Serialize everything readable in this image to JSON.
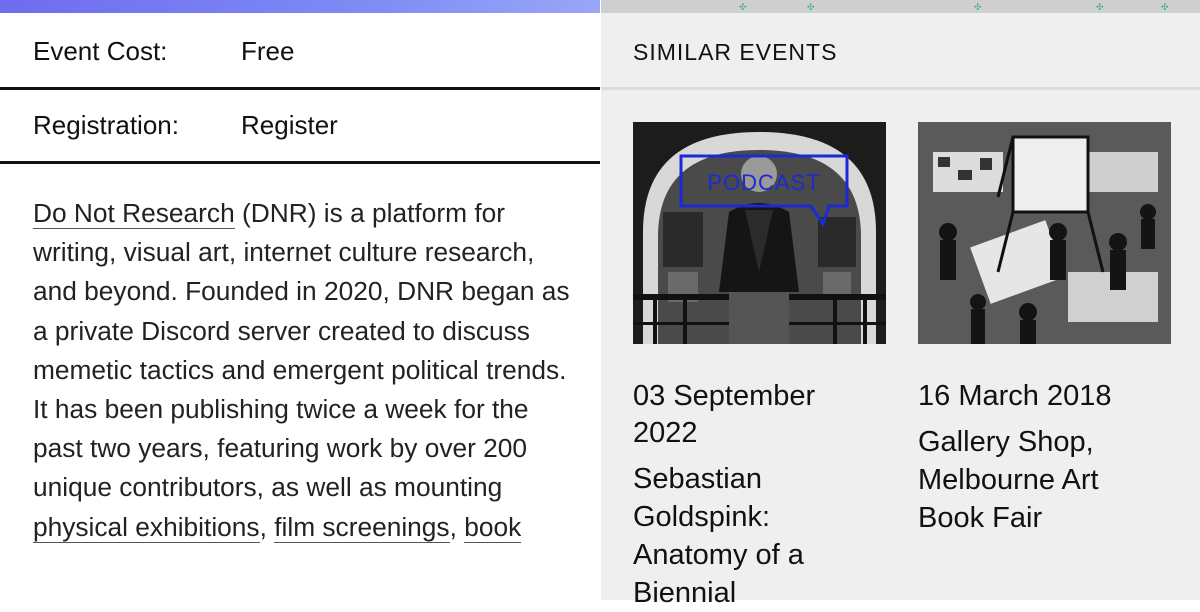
{
  "details": {
    "cost_label": "Event Cost:",
    "cost_value": "Free",
    "registration_label": "Registration:",
    "registration_value": "Register"
  },
  "description": {
    "link_dnr": "Do Not Research",
    "text_1": " (DNR) is a platform for writing, visual art, internet culture research, and beyond. Founded in 2020, DNR began as a private Discord server created to discuss memetic tactics and emergent political trends. It has been publishing twice a week for the past two years, featuring work by over 200 unique contributors, as well as mounting ",
    "link_exhibitions": "physical exhibitions",
    "sep_1": ", ",
    "link_film": "film screenings",
    "sep_2": ", ",
    "link_book": "book"
  },
  "similar": {
    "heading": "SIMILAR EVENTS",
    "events": [
      {
        "date": "03 September 2022",
        "title": "Sebastian Goldspink: Anatomy of a Biennial",
        "badge": "PODCAST",
        "image_icon": "podcast-photo"
      },
      {
        "date": "16 March 2018",
        "title": "Gallery Shop, Melbourne Art Book Fair",
        "image_icon": "book-fair-photo"
      }
    ]
  },
  "colors": {
    "accent_gradient_start": "#6f6cf0",
    "accent_gradient_end": "#9aa6f7",
    "badge_blue": "#1a2bd6",
    "right_panel_bg": "#efefef"
  }
}
